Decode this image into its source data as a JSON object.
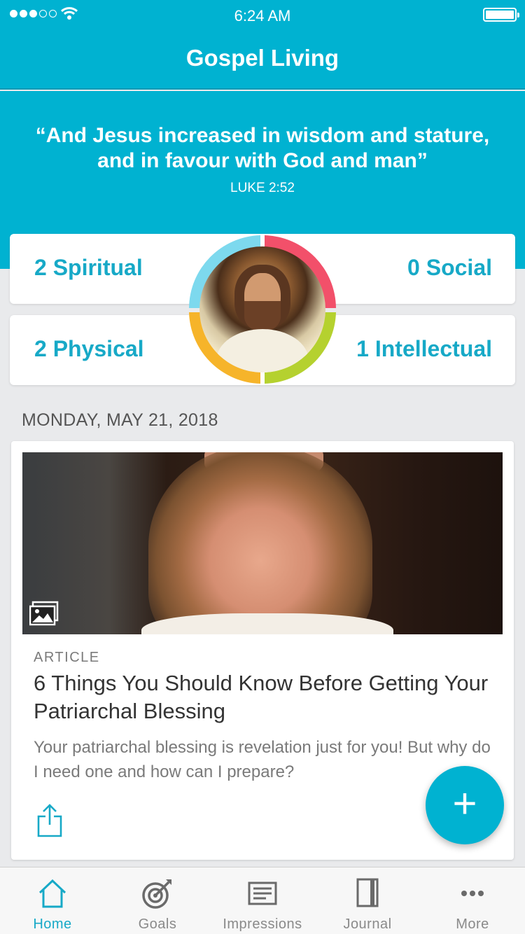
{
  "status_bar": {
    "time": "6:24 AM",
    "signal_bars_on": 3,
    "signal_bars_total": 5,
    "battery_level": 1.0
  },
  "nav": {
    "title": "Gospel Living"
  },
  "hero": {
    "quote_line1": "“And Jesus increased in wisdom and stature,",
    "quote_line2": "and in favour with God and man”",
    "reference": "LUKE 2:52"
  },
  "categories": {
    "spiritual": "2 Spiritual",
    "social": "0 Social",
    "physical": "2 Physical",
    "intellectual": "1 Intellectual"
  },
  "ring_colors": {
    "spiritual": "#7dd9ee",
    "social": "#f2506a",
    "physical": "#f6b42a",
    "intellectual": "#b5d12f"
  },
  "feed": {
    "date": "MONDAY, MAY 21, 2018",
    "article": {
      "type": "ARTICLE",
      "title": "6 Things You Should Know Before Getting Your Patriarchal Blessing",
      "summary": "Your patriarchal blessing is revelation just for you! But why do I need one and how can I prepare?",
      "media_icon": "gallery-icon",
      "share_icon": "share-icon"
    }
  },
  "fab": {
    "label": "+"
  },
  "tabs": [
    {
      "label": "Home",
      "icon": "home-icon",
      "active": true
    },
    {
      "label": "Goals",
      "icon": "target-icon",
      "active": false
    },
    {
      "label": "Impressions",
      "icon": "impressions-icon",
      "active": false
    },
    {
      "label": "Journal",
      "icon": "journal-icon",
      "active": false
    },
    {
      "label": "More",
      "icon": "more-icon",
      "active": false
    }
  ],
  "colors": {
    "brand": "#00b2d1",
    "accent_text": "#17a9c7",
    "background": "#e9eaec"
  }
}
